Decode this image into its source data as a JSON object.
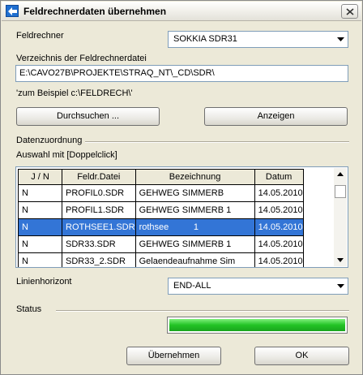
{
  "window": {
    "title": "Feldrechnerdaten übernehmen"
  },
  "feldrechner": {
    "label": "Feldrechner",
    "value": "SOKKIA SDR31"
  },
  "verzeichnis": {
    "label": "Verzeichnis der Feldrechnerdatei",
    "value": "E:\\CAVO27B\\PROJEKTE\\STRAQ_NT\\_CD\\SDR\\",
    "hint": "'zum Beispiel c:\\FELDRECH\\'"
  },
  "buttons": {
    "durchsuchen": "Durchsuchen ...",
    "anzeigen": "Anzeigen",
    "uebernehmen": "Übernehmen",
    "ok": "OK"
  },
  "datenzuordnung": {
    "label": "Datenzuordnung",
    "sublabel": "Auswahl mit [Doppelclick]",
    "columns": [
      "J / N",
      "Feldr.Datei",
      "Bezeichnung",
      "Datum"
    ],
    "rows": [
      [
        "N",
        "PROFIL0.SDR",
        "GEHWEG SIMMERB",
        "14.05.2010"
      ],
      [
        "N",
        "PROFIL1.SDR",
        "GEHWEG SIMMERB  1",
        "14.05.2010"
      ],
      [
        "N",
        "ROTHSEE1.SDR",
        "rothsee          1",
        "14.05.2010"
      ],
      [
        "N",
        "SDR33.SDR",
        "GEHWEG SIMMERB  1",
        "14.05.2010"
      ],
      [
        "N",
        "SDR33_2.SDR",
        "Gelaendeaufnahme Sim",
        "14.05.2010"
      ]
    ],
    "selected_row": 2
  },
  "linienhorizont": {
    "label": "Linienhorizont",
    "value": "END-ALL"
  },
  "status": {
    "label": "Status",
    "progress": 1.0
  },
  "colors": {
    "selection": "#3375d6",
    "progress": "#22c325",
    "title_icon": "#1f6fd0"
  }
}
